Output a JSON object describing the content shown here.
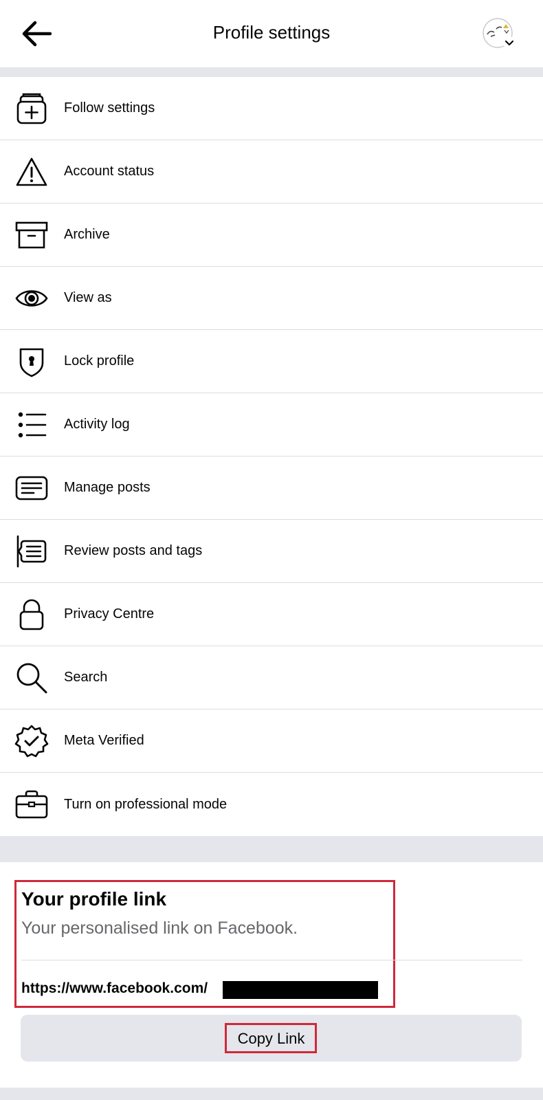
{
  "header": {
    "title": "Profile settings",
    "back_icon": "arrow-left-icon",
    "avatar_icon": "profile-avatar-with-chevron"
  },
  "menu": {
    "items": [
      {
        "label": "Follow settings",
        "icon": "follow-settings-icon"
      },
      {
        "label": "Account status",
        "icon": "warning-triangle-icon"
      },
      {
        "label": "Archive",
        "icon": "archive-box-icon"
      },
      {
        "label": "View as",
        "icon": "eye-icon"
      },
      {
        "label": "Lock profile",
        "icon": "shield-lock-icon"
      },
      {
        "label": "Activity log",
        "icon": "list-icon"
      },
      {
        "label": "Manage posts",
        "icon": "posts-icon"
      },
      {
        "label": "Review posts and tags",
        "icon": "review-posts-icon"
      },
      {
        "label": "Privacy Centre",
        "icon": "padlock-icon"
      },
      {
        "label": "Search",
        "icon": "search-icon"
      },
      {
        "label": "Meta Verified",
        "icon": "verified-badge-icon"
      },
      {
        "label": "Turn on professional mode",
        "icon": "briefcase-icon"
      }
    ]
  },
  "profile_link": {
    "heading": "Your profile link",
    "subtitle": "Your personalised link on Facebook.",
    "url": "https://www.facebook.com/",
    "copy_label": "Copy Link"
  },
  "colors": {
    "highlight": "#d0283a",
    "background": "#e4e6eb",
    "text": "#050505",
    "secondary_text": "#65676b"
  }
}
